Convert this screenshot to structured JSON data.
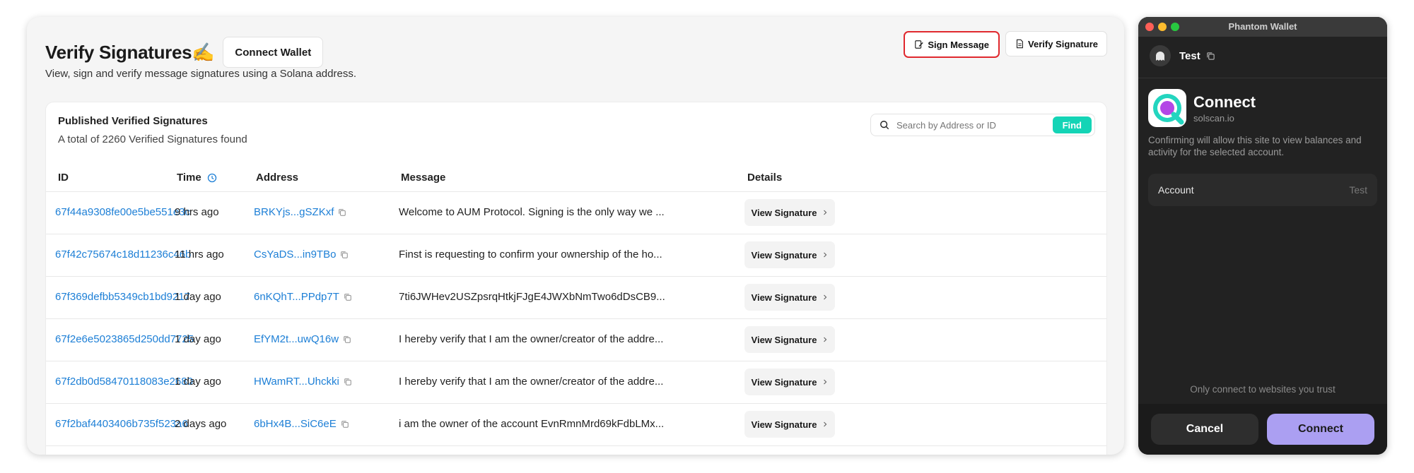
{
  "page": {
    "title": "Verify Signatures",
    "title_emoji": "✍️",
    "connect_wallet_label": "Connect Wallet",
    "subtitle": "View, sign and verify message signatures using a Solana address.",
    "sign_message_label": "Sign Message",
    "verify_signature_label": "Verify Signature"
  },
  "card": {
    "title": "Published Verified Signatures",
    "count_text": "A total of 2260 Verified Signatures found",
    "search_placeholder": "Search by Address or ID",
    "find_label": "Find"
  },
  "table": {
    "headers": {
      "id": "ID",
      "time": "Time",
      "address": "Address",
      "message": "Message",
      "details": "Details"
    },
    "view_label": "View Signature",
    "rows": [
      {
        "id": "67f44a9308fe00e5be551e3c",
        "time": "9 hrs ago",
        "address": "BRKYjs...gSZKxf",
        "message": "Welcome to AUM Protocol. Signing is the only way we ..."
      },
      {
        "id": "67f42c75674c18d11236c46b",
        "time": "11 hrs ago",
        "address": "CsYaDS...in9TBo",
        "message": "Finst is requesting to confirm your ownership of the ho..."
      },
      {
        "id": "67f369defbb5349cb1bd9217",
        "time": "1 day ago",
        "address": "6nKQhT...PPdp7T",
        "message": "7ti6JWHev2USZpsrqHtkjFJgE4JWXbNmTwo6dDsCB9..."
      },
      {
        "id": "67f2e6e5023865d250dd7725",
        "time": "1 day ago",
        "address": "EfYM2t...uwQ16w",
        "message": "I hereby verify that I am the owner/creator of the addre..."
      },
      {
        "id": "67f2db0d58470118083e2680",
        "time": "1 day ago",
        "address": "HWamRT...Uhckki",
        "message": "I hereby verify that I am the owner/creator of the addre..."
      },
      {
        "id": "67f2baf4403406b735f523a6",
        "time": "2 days ago",
        "address": "6bHx4B...SiC6eE",
        "message": "i am the owner of the account EvnRmnMrd69kFdbLMx..."
      }
    ]
  },
  "phantom": {
    "window_title": "Phantom Wallet",
    "account_name": "Test",
    "connect_title": "Connect",
    "site": "solscan.io",
    "description": "Confirming will allow this site to view balances and activity for the selected account.",
    "account_label": "Account",
    "account_value": "Test",
    "trust_note": "Only connect to websites you trust",
    "cancel_label": "Cancel",
    "connect_label": "Connect"
  },
  "colors": {
    "link": "#1d7fd6",
    "find": "#14d4b6",
    "highlight": "#e0282e",
    "phantom_accent": "#ab9ff2",
    "phantom_bg": "#222222"
  },
  "icons": [
    "sign-icon",
    "document-icon",
    "search-icon",
    "clock-icon",
    "copy-icon",
    "chevron-right-icon",
    "ghost-icon",
    "solscan-logo-icon"
  ]
}
